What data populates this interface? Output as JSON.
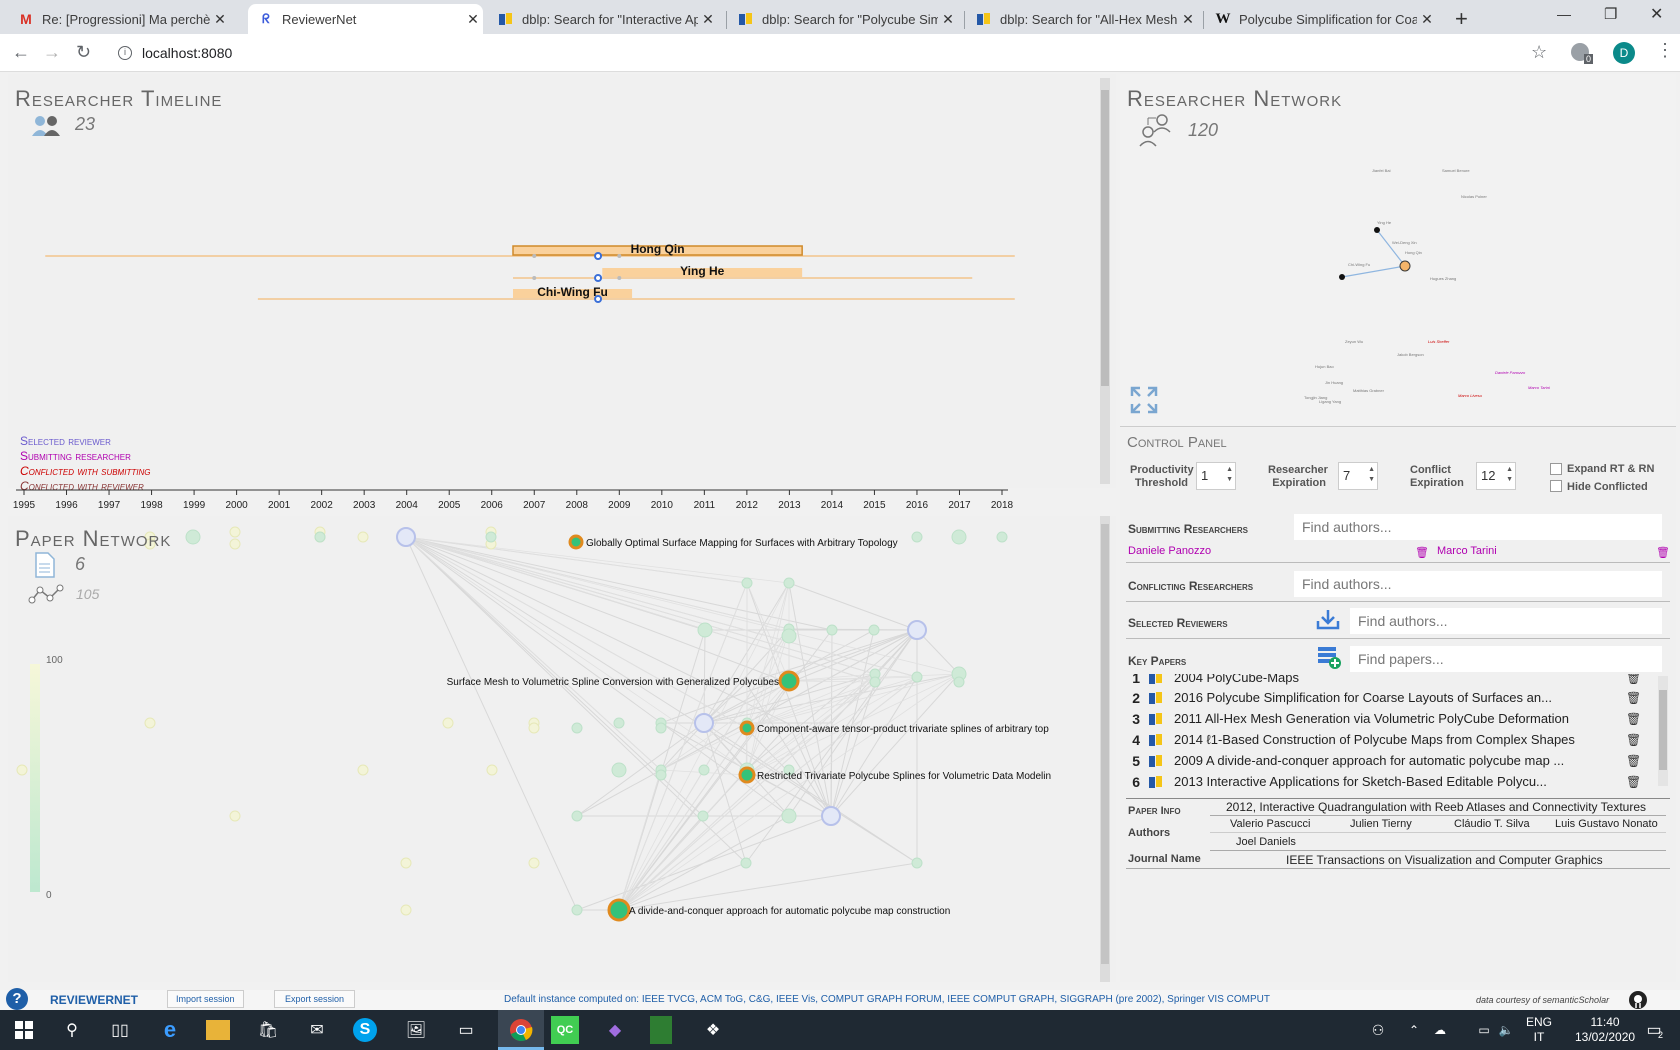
{
  "browser": {
    "tabs": [
      {
        "title": "Re: [Progressioni] Ma perchè? (Fw",
        "favicon": "gmail-icon"
      },
      {
        "title": "ReviewerNet",
        "favicon": "reviewernet-icon"
      },
      {
        "title": "dblp: Search for \"Interactive Appl",
        "favicon": "dblp-icon"
      },
      {
        "title": "dblp: Search for \"Polycube Simpl",
        "favicon": "dblp-icon"
      },
      {
        "title": "dblp: Search for \"All-Hex Mesh G",
        "favicon": "dblp-icon"
      },
      {
        "title": "Polycube Simplification for Coars",
        "favicon": "wikipedia-icon"
      }
    ],
    "url": "localhost:8080",
    "profile_initial": "D",
    "ext_badge": "0"
  },
  "timeline": {
    "title": "Researcher Timeline",
    "count": "23",
    "researchers": [
      {
        "name": "Hong Qin",
        "start": 2006.5,
        "end": 2013.3,
        "line_start": 1995.5,
        "line_end": 2018.3
      },
      {
        "name": "Ying He",
        "start": 2008.6,
        "end": 2013.3,
        "line_start": 2006.5,
        "line_end": 2017.3
      },
      {
        "name": "Chi-Wing Fu",
        "start": 2006.5,
        "end": 2009.3,
        "line_start": 2000.5,
        "line_end": 2018.3
      }
    ],
    "legend": {
      "selected": "Selected reviewer",
      "submitting": "Submitting researcher",
      "conflicted_submitting": "Conflicted with submitting",
      "conflicted_reviewer": "Conflicted with reviewer"
    },
    "axis_years": [
      "1995",
      "1996",
      "1997",
      "1998",
      "1999",
      "2000",
      "2001",
      "2002",
      "2003",
      "2004",
      "2005",
      "2006",
      "2007",
      "2008",
      "2009",
      "2010",
      "2011",
      "2012",
      "2013",
      "2014",
      "2015",
      "2016",
      "2017",
      "2018"
    ]
  },
  "network": {
    "title": "Researcher Network",
    "count": "120",
    "nodes": [
      "Jianfei Bai",
      "Samuel Benure",
      "Nicolas Polner",
      "Ying He",
      "Wei-Deng Xin",
      "Hong Qin",
      "Chi-Wing Fu",
      "Hugues Zhang",
      "Zeyun Wu",
      "Luis Sheffer",
      "Jakob Bergson",
      "Hujun Bao",
      "Jin Huang",
      "Matthias Grabner",
      "Daniele Panozzo",
      "Marco Tarini",
      "Marco Livesu",
      "Tongjin Jiang",
      "Ligang Yang"
    ]
  },
  "control": {
    "title": "Control Panel",
    "productivity_label": "Productivity Threshold",
    "productivity": "1",
    "expiration_label": "Researcher Expiration",
    "expiration": "7",
    "conflict_label": "Conflict Expiration",
    "conflict": "12",
    "expand_label": "Expand RT & RN",
    "hide_label": "Hide Conflicted",
    "submitting_label": "Submitting Researchers",
    "conflicting_label": "Conflicting Researchers",
    "selected_label": "Selected Reviewers",
    "keypapers_label": "Key Papers",
    "find_authors": "Find authors...",
    "find_papers": "Find papers...",
    "submitting": [
      "Daniele Panozzo",
      "Marco Tarini"
    ]
  },
  "key_papers": [
    {
      "n": "1",
      "text": "2004 PolyCube-Maps"
    },
    {
      "n": "2",
      "text": "2016 Polycube Simplification for Coarse Layouts of Surfaces an..."
    },
    {
      "n": "3",
      "text": "2011 All-Hex Mesh Generation via Volumetric PolyCube Deformation"
    },
    {
      "n": "4",
      "text": "2014 ℓ1-Based Construction of Polycube Maps from Complex Shapes"
    },
    {
      "n": "5",
      "text": "2009 A divide-and-conquer approach for automatic polycube map ..."
    },
    {
      "n": "6",
      "text": "2013 Interactive Applications for Sketch-Based Editable Polycu..."
    }
  ],
  "paper_info": {
    "label": "Paper Info",
    "title": "2012, Interactive Quadrangulation with Reeb Atlases and Connectivity Textures",
    "authors_label": "Authors",
    "authors": [
      "Valerio Pascucci",
      "Julien Tierny",
      "Cláudio T. Silva",
      "Luis Gustavo Nonato",
      "Joel Daniels"
    ],
    "journal_label": "Journal Name",
    "journal": "IEEE Transactions on Visualization and Computer Graphics"
  },
  "paper_network": {
    "title": "Paper Network",
    "paper_count": "6",
    "link_count": "105",
    "scale_max": "100",
    "scale_min": "0",
    "labels": [
      "Globally Optimal Surface Mapping for Surfaces with Arbitrary Topology",
      "Surface Mesh to Volumetric Spline Conversion with Generalized Polycubes",
      "Component-aware tensor-product trivariate splines of arbitrary top",
      "Restricted Trivariate Polycube Splines for Volumetric Data Modelin",
      "A divide-and-conquer approach for automatic polycube map construction"
    ]
  },
  "status": {
    "brand": "REVIEWERNET",
    "import": "Import session",
    "export": "Export session",
    "instance": "Default instance computed on: IEEE TVCG, ACM ToG, C&G, IEEE Vis, COMPUT GRAPH FORUM, IEEE COMPUT GRAPH, SIGGRAPH (pre 2002), Springer VIS COMPUT",
    "credit": "data courtesy of semanticScholar"
  },
  "taskbar": {
    "lang1": "ENG",
    "lang2": "IT",
    "time": "11:40",
    "date": "13/02/2020",
    "notif": "2"
  },
  "colors": {
    "bar": "#fad19c",
    "bar_border": "#d08a2a",
    "selected": "#6a5acd",
    "submitting": "#b000b0",
    "conflicted": "#cc0000",
    "accent": "#1a73e8"
  }
}
